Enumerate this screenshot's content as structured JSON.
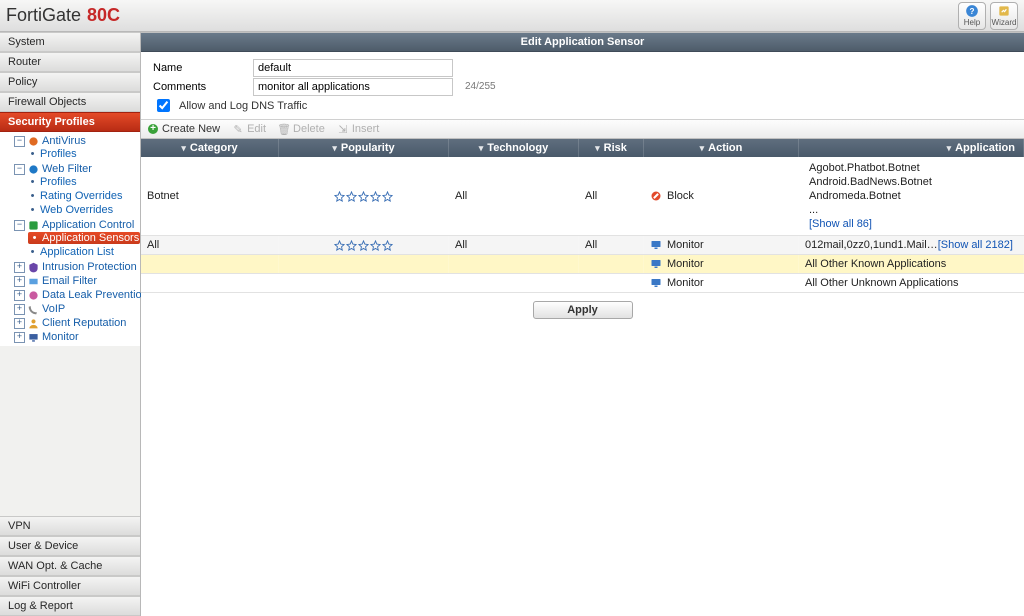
{
  "brand": {
    "name": "FortiGate",
    "model": "80C"
  },
  "top_buttons": {
    "help": "Help",
    "wizard": "Wizard"
  },
  "sidebar_sections": {
    "top": [
      "System",
      "Router",
      "Policy",
      "Firewall Objects"
    ],
    "active": "Security Profiles",
    "bottom": [
      "VPN",
      "User & Device",
      "WAN Opt. & Cache",
      "WiFi Controller",
      "Log & Report"
    ]
  },
  "tree": {
    "antivirus": {
      "label": "AntiVirus",
      "children": [
        "Profiles"
      ]
    },
    "webfilter": {
      "label": "Web Filter",
      "children": [
        "Profiles",
        "Rating Overrides",
        "Web Overrides"
      ]
    },
    "appcontrol": {
      "label": "Application Control",
      "children": [
        "Application Sensors",
        "Application List"
      ]
    },
    "intrusion": "Intrusion Protection",
    "email": "Email Filter",
    "dlp": "Data Leak Prevention",
    "voip": "VoIP",
    "clientrep": "Client Reputation",
    "monitor": "Monitor"
  },
  "panel": {
    "title": "Edit Application Sensor"
  },
  "form": {
    "name_label": "Name",
    "name_value": "default",
    "comments_label": "Comments",
    "comments_value": "monitor all applications",
    "comments_hint": "24/255",
    "dns_label": "Allow and Log DNS Traffic"
  },
  "toolbar": {
    "create": "Create New",
    "edit": "Edit",
    "delete": "Delete",
    "insert": "Insert"
  },
  "grid": {
    "headers": {
      "category": "Category",
      "popularity": "Popularity",
      "technology": "Technology",
      "risk": "Risk",
      "action": "Action",
      "application": "Application"
    },
    "rows": [
      {
        "category": "Botnet",
        "popularity": 5,
        "technology": "All",
        "risk": "All",
        "action": {
          "type": "block",
          "label": "Block"
        },
        "apps": [
          "Agobot.Phatbot.Botnet",
          "Android.BadNews.Botnet",
          "Andromeda.Botnet",
          "..."
        ],
        "show_all": "[Show all 86]"
      },
      {
        "category": "All",
        "popularity": 5,
        "technology": "All",
        "risk": "All",
        "action": {
          "type": "monitor",
          "label": "Monitor"
        },
        "app_inline": "012mail,0zz0,1und1.Mail…",
        "show_all": "[Show all 2182]",
        "alt": true
      },
      {
        "action": {
          "type": "monitor",
          "label": "Monitor"
        },
        "app_inline": "All Other Known Applications",
        "yellow": true
      },
      {
        "action": {
          "type": "monitor",
          "label": "Monitor"
        },
        "app_inline": "All Other Unknown Applications"
      }
    ]
  },
  "apply": "Apply"
}
